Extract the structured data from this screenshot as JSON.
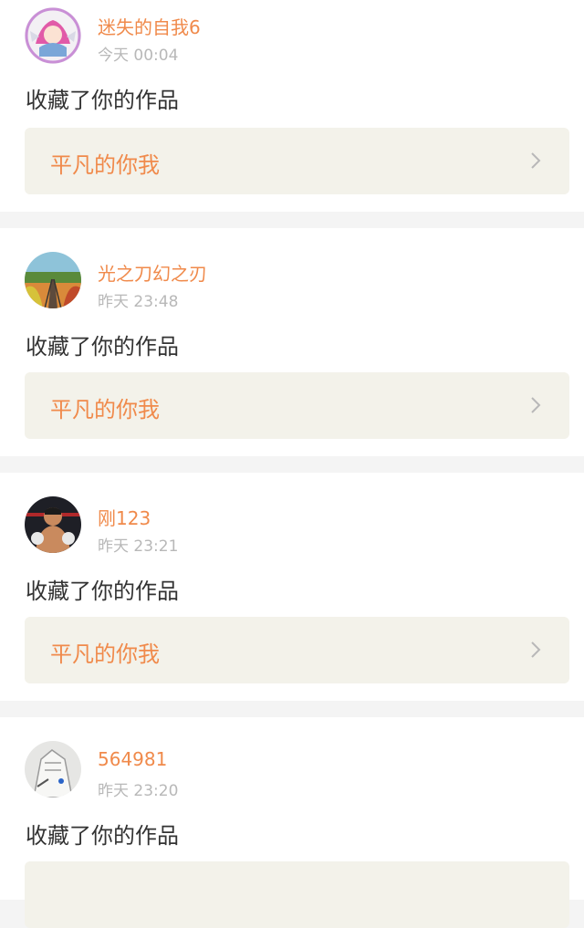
{
  "action_text": "收藏了你的作品",
  "colors": {
    "accent": "#f08a4b",
    "work_bg": "#f3f2ea",
    "meta": "#b8b8b8"
  },
  "notifications": [
    {
      "username": "迷失的自我6",
      "time": "今天 00:04",
      "work_title": "平凡的你我",
      "avatar": "anime-girl-avatar"
    },
    {
      "username": "光之刀幻之刃",
      "time": "昨天 23:48",
      "work_title": "平凡的你我",
      "avatar": "railway-landscape-avatar"
    },
    {
      "username": "刚123",
      "time": "昨天 23:21",
      "work_title": "平凡的你我",
      "avatar": "fighter-avatar"
    },
    {
      "username": "564981",
      "time": "昨天 23:20",
      "work_title": "",
      "avatar": "sketch-avatar"
    }
  ]
}
